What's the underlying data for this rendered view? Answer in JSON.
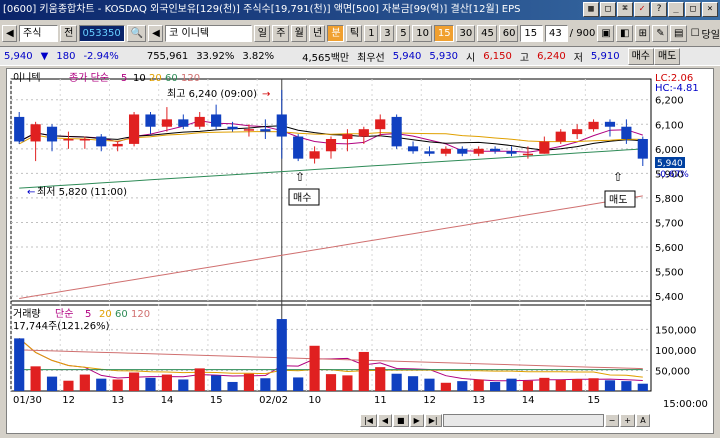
{
  "title": "[0600] 키움종합차트 - KOSDAQ 외국인보유[129(천)] 주식수[19,791(천)] 액면[500] 자본금[99(억)] 결산[12월] EPS",
  "toolbar": {
    "mode": "주식",
    "prefix": "전",
    "code": "053350",
    "name": "코 이니텍",
    "periods": [
      "일",
      "주",
      "월",
      "년"
    ],
    "bun": "분",
    "tick": "틱",
    "minutes": [
      "1",
      "3",
      "5",
      "10",
      "15",
      "30",
      "45",
      "60",
      "15"
    ],
    "count": "43",
    "total": "/ 900",
    "draw_label": "당일"
  },
  "quote": {
    "price": "5,940",
    "arrow": "▼",
    "change": "180",
    "rate": "-2.94%",
    "volume": "755,961",
    "ratio": "33.92%",
    "turnover": "3.82%",
    "amount": "4,565백만",
    "best_label": "최우선",
    "ask": "5,940",
    "bid": "5,930",
    "open_label": "시",
    "open": "6,150",
    "high_label": "고",
    "high": "6,240",
    "low_label": "저",
    "low": "5,910",
    "sell_btn": "매수",
    "buy_btn": "매도"
  },
  "colors": {
    "up": "#e02020",
    "down": "#1040c0",
    "ma5": "#b00080",
    "ma10": "#000000",
    "ma20": "#e0a000",
    "ma60": "#2e8b57",
    "ma120": "#d07070"
  },
  "price_panel": {
    "legend_name": "이니텍",
    "legend_ma": "종가 단순",
    "periods": [
      "5",
      "10",
      "20",
      "60",
      "120"
    ],
    "lc": "LC:2.06",
    "hc": "HC:-4.81",
    "high_note": "최고 6,240 (09:00)",
    "low_note": "최저 5,820 (11:00)",
    "buy_tag": "매수",
    "sell_tag": "매도",
    "cur_price": "5,940",
    "cur_rate": "-0.67%",
    "y_ticks": [
      "6,200",
      "6,100",
      "6,000",
      "5,900",
      "5,800",
      "5,700",
      "5,600",
      "5,500",
      "5,400"
    ]
  },
  "volume_panel": {
    "legend_name": "거래량",
    "legend_ma": "단순",
    "periods": [
      "5",
      "20",
      "60",
      "120"
    ],
    "vol_note": "17,744주(121.26%)",
    "y_ticks": [
      "150,000",
      "100,000",
      "50,000"
    ]
  },
  "x_axis": {
    "labels": [
      "01/30",
      "12",
      "13",
      "14",
      "15",
      "02/02",
      "10",
      "11",
      "12",
      "13",
      "14",
      "15"
    ],
    "time": "15:00:00"
  },
  "candles": [
    [
      6130,
      6030,
      6150,
      6020
    ],
    [
      6030,
      6100,
      6110,
      5950
    ],
    [
      6090,
      6030,
      6100,
      5990
    ],
    [
      6040,
      6040,
      6070,
      6000
    ],
    [
      6040,
      6040,
      6050,
      6000
    ],
    [
      6050,
      6010,
      6060,
      5990
    ],
    [
      6010,
      6020,
      6030,
      5990
    ],
    [
      6020,
      6140,
      6150,
      6010
    ],
    [
      6140,
      6090,
      6150,
      6060
    ],
    [
      6090,
      6120,
      6170,
      6070
    ],
    [
      6120,
      6090,
      6140,
      6080
    ],
    [
      6090,
      6130,
      6150,
      6080
    ],
    [
      6140,
      6090,
      6180,
      6080
    ],
    [
      6090,
      6080,
      6110,
      6070
    ],
    [
      6080,
      6080,
      6100,
      6050
    ],
    [
      6080,
      6070,
      6120,
      6040
    ],
    [
      6140,
      6050,
      6240,
      5960
    ],
    [
      6050,
      5960,
      6060,
      5950
    ],
    [
      5960,
      5990,
      6010,
      5940
    ],
    [
      5990,
      6040,
      6050,
      5960
    ],
    [
      6040,
      6060,
      6080,
      5990
    ],
    [
      6050,
      6080,
      6090,
      6020
    ],
    [
      6080,
      6120,
      6140,
      6050
    ],
    [
      6130,
      6010,
      6140,
      6000
    ],
    [
      6010,
      5990,
      6030,
      5980
    ],
    [
      5990,
      5980,
      6010,
      5970
    ],
    [
      5980,
      6000,
      6010,
      5970
    ],
    [
      6000,
      5980,
      6010,
      5970
    ],
    [
      5980,
      6000,
      6010,
      5970
    ],
    [
      6000,
      5990,
      6010,
      5980
    ],
    [
      5990,
      5980,
      6010,
      5970
    ],
    [
      5980,
      5980,
      6010,
      5960
    ],
    [
      5980,
      6030,
      6050,
      5980
    ],
    [
      6030,
      6070,
      6080,
      6020
    ],
    [
      6060,
      6080,
      6100,
      6040
    ],
    [
      6080,
      6110,
      6120,
      6070
    ],
    [
      6110,
      6090,
      6120,
      6050
    ],
    [
      6090,
      6040,
      6120,
      6020
    ],
    [
      6040,
      5960,
      6050,
      5930
    ]
  ],
  "volumes": [
    128000,
    60000,
    35000,
    25000,
    40000,
    30000,
    28000,
    45000,
    32000,
    40000,
    28000,
    55000,
    38000,
    22000,
    42000,
    31000,
    175000,
    33000,
    110000,
    41000,
    38000,
    95000,
    58000,
    42000,
    36000,
    30000,
    20000,
    24000,
    28000,
    22000,
    30000,
    25000,
    32000,
    27000,
    29000,
    31000,
    26000,
    24000,
    17744
  ]
}
